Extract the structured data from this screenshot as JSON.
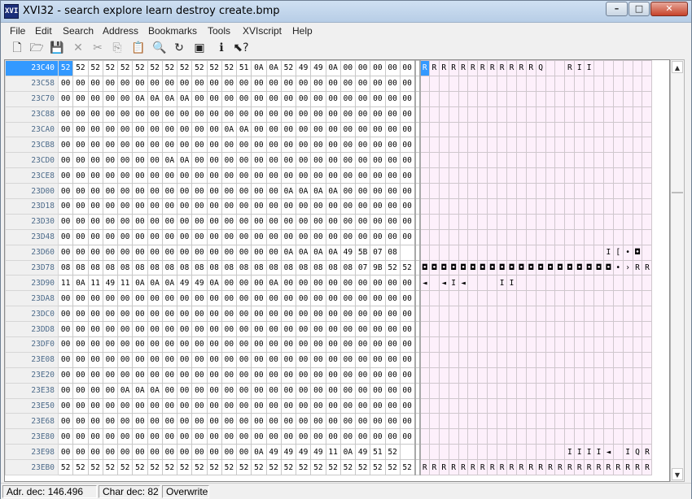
{
  "window": {
    "title": "XVI32 - search explore learn destroy create.bmp",
    "icon_text": "XVI",
    "minimize": "–",
    "maximize": "□",
    "close": "✕"
  },
  "menu": [
    "File",
    "Edit",
    "Search",
    "Address",
    "Bookmarks",
    "Tools",
    "XVIscript",
    "Help"
  ],
  "toolbar": [
    {
      "icon": "new-file-icon",
      "glyph": "🗋",
      "enabled": true
    },
    {
      "icon": "open-folder-icon",
      "glyph": "🗁",
      "enabled": true
    },
    {
      "icon": "save-icon",
      "glyph": "💾",
      "enabled": true
    },
    {
      "icon": "delete-icon",
      "glyph": "✕",
      "enabled": false
    },
    {
      "icon": "cut-icon",
      "glyph": "✂",
      "enabled": false
    },
    {
      "icon": "copy-icon",
      "glyph": "⎘",
      "enabled": false
    },
    {
      "icon": "paste-icon",
      "glyph": "📋",
      "enabled": true
    },
    {
      "icon": "find-icon",
      "glyph": "🔍",
      "enabled": true
    },
    {
      "icon": "find-next-icon",
      "glyph": "↻",
      "enabled": true
    },
    {
      "icon": "replace-icon",
      "glyph": "▣",
      "enabled": true
    },
    {
      "icon": "script-icon",
      "glyph": "ℹ",
      "enabled": true
    },
    {
      "icon": "context-help-icon",
      "glyph": "⬉?",
      "enabled": true
    }
  ],
  "hex_rows": [
    {
      "addr": "23C40",
      "hex": "52 52 52 52 52 52 52 52 52 52 52 52 51 0A 0A 52 49 49 0A 00 00 00 00 00",
      "ascii": "RRRRRRRRRRRRQ  RII      "
    },
    {
      "addr": "23C58",
      "hex": "00 00 00 00 00 00 00 00 00 00 00 00 00 00 00 00 00 00 00 00 00 00 00 00",
      "ascii": "                        "
    },
    {
      "addr": "23C70",
      "hex": "00 00 00 00 00 0A 0A 0A 0A 00 00 00 00 00 00 00 00 00 00 00 00 00 00 00",
      "ascii": "                        "
    },
    {
      "addr": "23C88",
      "hex": "00 00 00 00 00 00 00 00 00 00 00 00 00 00 00 00 00 00 00 00 00 00 00 00",
      "ascii": "                        "
    },
    {
      "addr": "23CA0",
      "hex": "00 00 00 00 00 00 00 00 00 00 00 0A 0A 00 00 00 00 00 00 00 00 00 00 00",
      "ascii": "                        "
    },
    {
      "addr": "23CB8",
      "hex": "00 00 00 00 00 00 00 00 00 00 00 00 00 00 00 00 00 00 00 00 00 00 00 00",
      "ascii": "                        "
    },
    {
      "addr": "23CD0",
      "hex": "00 00 00 00 00 00 00 0A 0A 00 00 00 00 00 00 00 00 00 00 00 00 00 00 00",
      "ascii": "                        "
    },
    {
      "addr": "23CE8",
      "hex": "00 00 00 00 00 00 00 00 00 00 00 00 00 00 00 00 00 00 00 00 00 00 00 00",
      "ascii": "                        "
    },
    {
      "addr": "23D00",
      "hex": "00 00 00 00 00 00 00 00 00 00 00 00 00 00 00 0A 0A 0A 0A 00 00 00 00 00",
      "ascii": "                        "
    },
    {
      "addr": "23D18",
      "hex": "00 00 00 00 00 00 00 00 00 00 00 00 00 00 00 00 00 00 00 00 00 00 00 00",
      "ascii": "                        "
    },
    {
      "addr": "23D30",
      "hex": "00 00 00 00 00 00 00 00 00 00 00 00 00 00 00 00 00 00 00 00 00 00 00 00",
      "ascii": "                        "
    },
    {
      "addr": "23D48",
      "hex": "00 00 00 00 00 00 00 00 00 00 00 00 00 00 00 00 00 00 00 00 00 00 00 00",
      "ascii": "                        "
    },
    {
      "addr": "23D60",
      "hex": "00 00 00 00 00 00 00 00 00 00 00 00 00 00 00 0A 0A 0A 0A 49 5B 07 08",
      "ascii": "                   I[•◘"
    },
    {
      "addr": "23D78",
      "hex": "08 08 08 08 08 08 08 08 08 08 08 08 08 08 08 08 08 08 08 08 07 9B 52 52",
      "ascii": "◘◘◘◘◘◘◘◘◘◘◘◘◘◘◘◘◘◘◘◘•›RR"
    },
    {
      "addr": "23D90",
      "hex": "11 0A 11 49 11 0A 0A 0A 49 49 0A 00 00 00 0A 00 00 00 00 00 00 00 00 00",
      "ascii": "◄ ◄I◄   II              "
    },
    {
      "addr": "23DA8",
      "hex": "00 00 00 00 00 00 00 00 00 00 00 00 00 00 00 00 00 00 00 00 00 00 00 00",
      "ascii": "                        "
    },
    {
      "addr": "23DC0",
      "hex": "00 00 00 00 00 00 00 00 00 00 00 00 00 00 00 00 00 00 00 00 00 00 00 00",
      "ascii": "                        "
    },
    {
      "addr": "23DD8",
      "hex": "00 00 00 00 00 00 00 00 00 00 00 00 00 00 00 00 00 00 00 00 00 00 00 00",
      "ascii": "                        "
    },
    {
      "addr": "23DF0",
      "hex": "00 00 00 00 00 00 00 00 00 00 00 00 00 00 00 00 00 00 00 00 00 00 00 00",
      "ascii": "                        "
    },
    {
      "addr": "23E08",
      "hex": "00 00 00 00 00 00 00 00 00 00 00 00 00 00 00 00 00 00 00 00 00 00 00 00",
      "ascii": "                        "
    },
    {
      "addr": "23E20",
      "hex": "00 00 00 00 00 00 00 00 00 00 00 00 00 00 00 00 00 00 00 00 00 00 00 00",
      "ascii": "                        "
    },
    {
      "addr": "23E38",
      "hex": "00 00 00 00 0A 0A 0A 00 00 00 00 00 00 00 00 00 00 00 00 00 00 00 00 00",
      "ascii": "                        "
    },
    {
      "addr": "23E50",
      "hex": "00 00 00 00 00 00 00 00 00 00 00 00 00 00 00 00 00 00 00 00 00 00 00 00",
      "ascii": "                        "
    },
    {
      "addr": "23E68",
      "hex": "00 00 00 00 00 00 00 00 00 00 00 00 00 00 00 00 00 00 00 00 00 00 00 00",
      "ascii": "                        "
    },
    {
      "addr": "23E80",
      "hex": "00 00 00 00 00 00 00 00 00 00 00 00 00 00 00 00 00 00 00 00 00 00 00 00",
      "ascii": "                        "
    },
    {
      "addr": "23E98",
      "hex": "00 00 00 00 00 00 00 00 00 00 00 00 00 0A 49 49 49 49 11 0A 49 51 52",
      "ascii": "               IIII◄ IQR"
    },
    {
      "addr": "23EB0",
      "hex": "52 52 52 52 52 52 52 52 52 52 52 52 52 52 52 52 52 52 52 52 52 52 52 52",
      "ascii": "RRRRRRRRRRRRRRRRRRRRRRRR"
    }
  ],
  "cursor": {
    "row": 0,
    "col": 0
  },
  "status": {
    "address": "Adr. dec: 146.496",
    "char": "Char dec: 82",
    "mode": "Overwrite"
  },
  "scroll": {
    "up": "▲",
    "down": "▼",
    "position": 0.3
  },
  "colors": {
    "selection": "#3399ff",
    "ascii_bg": "#fdf0fb",
    "address_text": "#4d6b8a"
  }
}
